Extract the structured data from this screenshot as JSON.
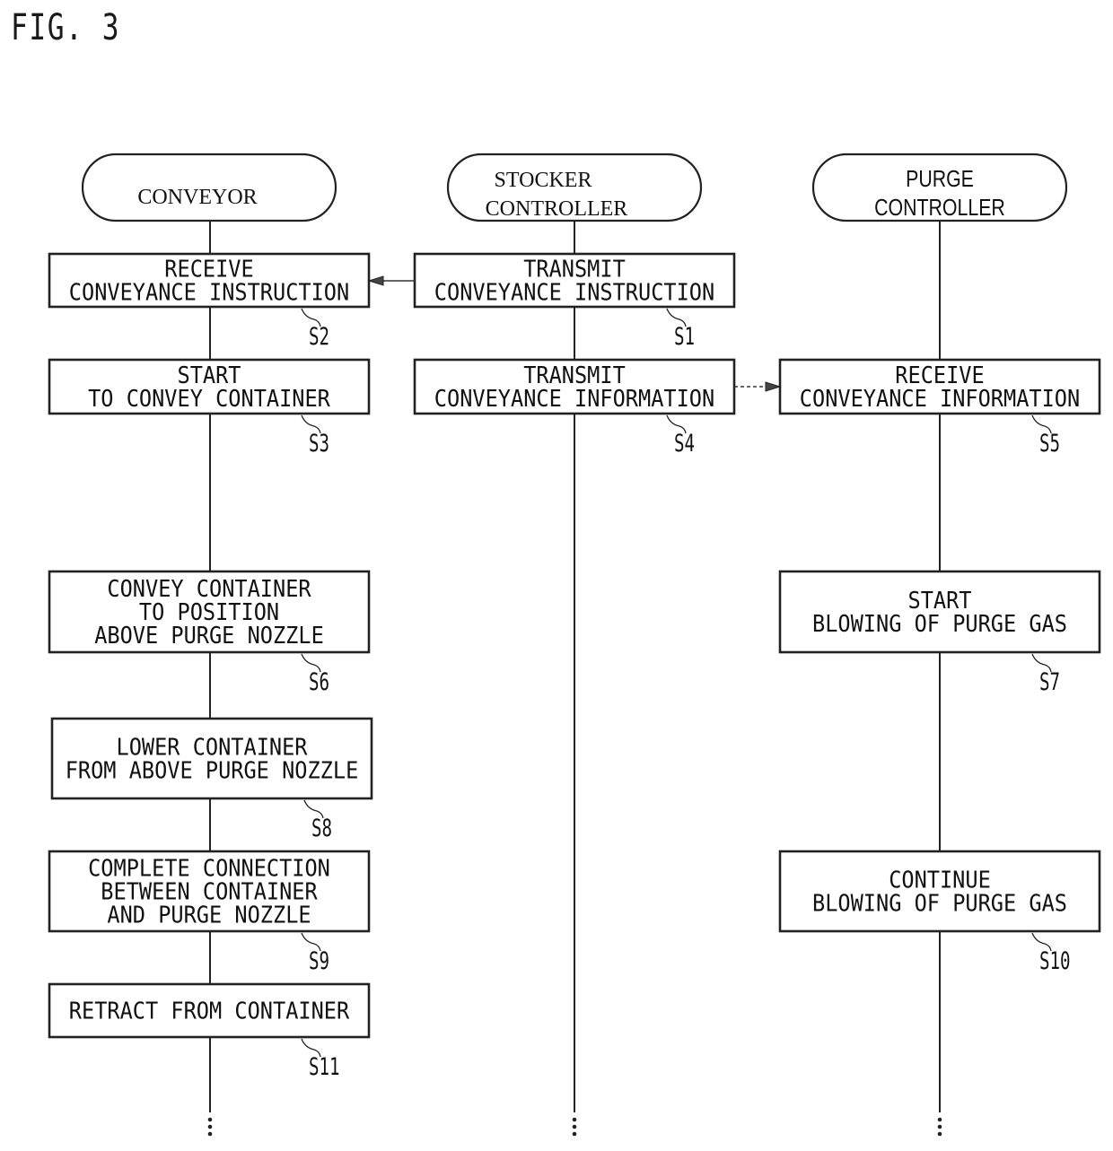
{
  "figure": {
    "title": "FIG. 3"
  },
  "lanes": [
    {
      "id": "conveyor",
      "label_lines": [
        "CONVEYOR"
      ]
    },
    {
      "id": "stocker",
      "label_lines": [
        "STOCKER",
        "CONTROLLER"
      ]
    },
    {
      "id": "purge",
      "label_lines": [
        "PURGE",
        "CONTROLLER"
      ]
    }
  ],
  "steps": [
    {
      "id": "S1",
      "lane": "stocker",
      "lines": [
        "TRANSMIT",
        "CONVEYANCE INSTRUCTION"
      ]
    },
    {
      "id": "S2",
      "lane": "conveyor",
      "lines": [
        "RECEIVE",
        "CONVEYANCE INSTRUCTION"
      ]
    },
    {
      "id": "S3",
      "lane": "conveyor",
      "lines": [
        "START",
        "TO CONVEY CONTAINER"
      ]
    },
    {
      "id": "S4",
      "lane": "stocker",
      "lines": [
        "TRANSMIT",
        "CONVEYANCE INFORMATION"
      ]
    },
    {
      "id": "S5",
      "lane": "purge",
      "lines": [
        "RECEIVE",
        "CONVEYANCE INFORMATION"
      ]
    },
    {
      "id": "S6",
      "lane": "conveyor",
      "lines": [
        "CONVEY CONTAINER",
        "TO POSITION",
        "ABOVE PURGE NOZZLE"
      ]
    },
    {
      "id": "S7",
      "lane": "purge",
      "lines": [
        "START",
        "BLOWING OF PURGE GAS"
      ]
    },
    {
      "id": "S8",
      "lane": "conveyor",
      "lines": [
        "LOWER CONTAINER",
        "FROM ABOVE PURGE NOZZLE"
      ]
    },
    {
      "id": "S9",
      "lane": "conveyor",
      "lines": [
        "COMPLETE CONNECTION",
        "BETWEEN CONTAINER",
        "AND PURGE NOZZLE"
      ]
    },
    {
      "id": "S10",
      "lane": "purge",
      "lines": [
        "CONTINUE",
        "BLOWING OF PURGE GAS"
      ]
    },
    {
      "id": "S11",
      "lane": "conveyor",
      "lines": [
        "RETRACT FROM CONTAINER"
      ]
    }
  ],
  "messages": [
    {
      "from": "S1",
      "to": "S2",
      "style": "solid"
    },
    {
      "from": "S4",
      "to": "S5",
      "style": "dashed"
    }
  ],
  "continuation": "⋮"
}
